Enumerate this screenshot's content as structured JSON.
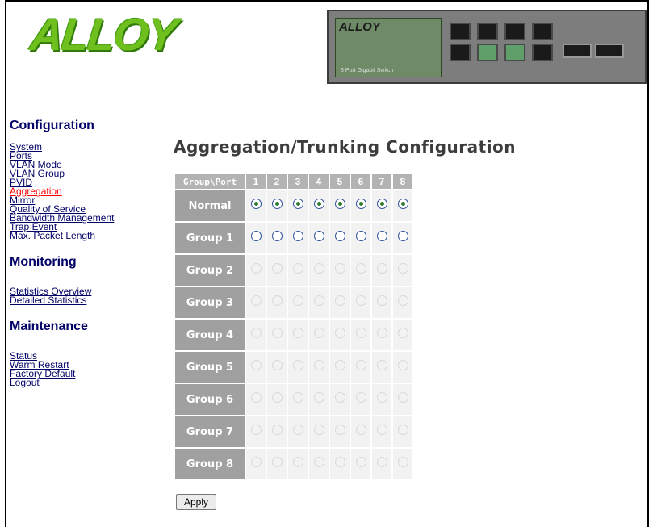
{
  "brand": {
    "logo": "ALLOY",
    "device_brand": "ALLOY",
    "device_caption": "8 Port Gigabit Switch"
  },
  "nav": {
    "config_heading": "Configuration",
    "config_links": [
      "System",
      "Ports",
      "VLAN Mode",
      "VLAN Group",
      "PVID",
      "Aggregation",
      "Mirror",
      "Quality of Service",
      "Bandwidth Management",
      "Trap Event",
      "Max. Packet Length"
    ],
    "active_link": "Aggregation",
    "monitoring_heading": "Monitoring",
    "monitoring_links": [
      "Statistics Overview",
      "Detailed Statistics"
    ],
    "maintenance_heading": "Maintenance",
    "maintenance_links": [
      "Status",
      "Warm Restart",
      "Factory Default",
      "Logout"
    ]
  },
  "page": {
    "title": "Aggregation/Trunking Configuration",
    "corner_header": "Group\\Port",
    "ports": [
      "1",
      "2",
      "3",
      "4",
      "5",
      "6",
      "7",
      "8"
    ],
    "rows": [
      {
        "label": "Normal",
        "state": "checked"
      },
      {
        "label": "Group 1",
        "state": "enabled"
      },
      {
        "label": "Group 2",
        "state": "disabled"
      },
      {
        "label": "Group 3",
        "state": "disabled"
      },
      {
        "label": "Group 4",
        "state": "disabled"
      },
      {
        "label": "Group 5",
        "state": "disabled"
      },
      {
        "label": "Group 6",
        "state": "disabled"
      },
      {
        "label": "Group 7",
        "state": "disabled"
      },
      {
        "label": "Group 8",
        "state": "disabled"
      }
    ],
    "apply_label": "Apply"
  },
  "colors": {
    "nav_link": "#000066",
    "active_link": "#ff0000",
    "header_cell": "#b3b3b3",
    "row_label": "#a0a0a0",
    "logo_green": "#6fbf1f"
  }
}
